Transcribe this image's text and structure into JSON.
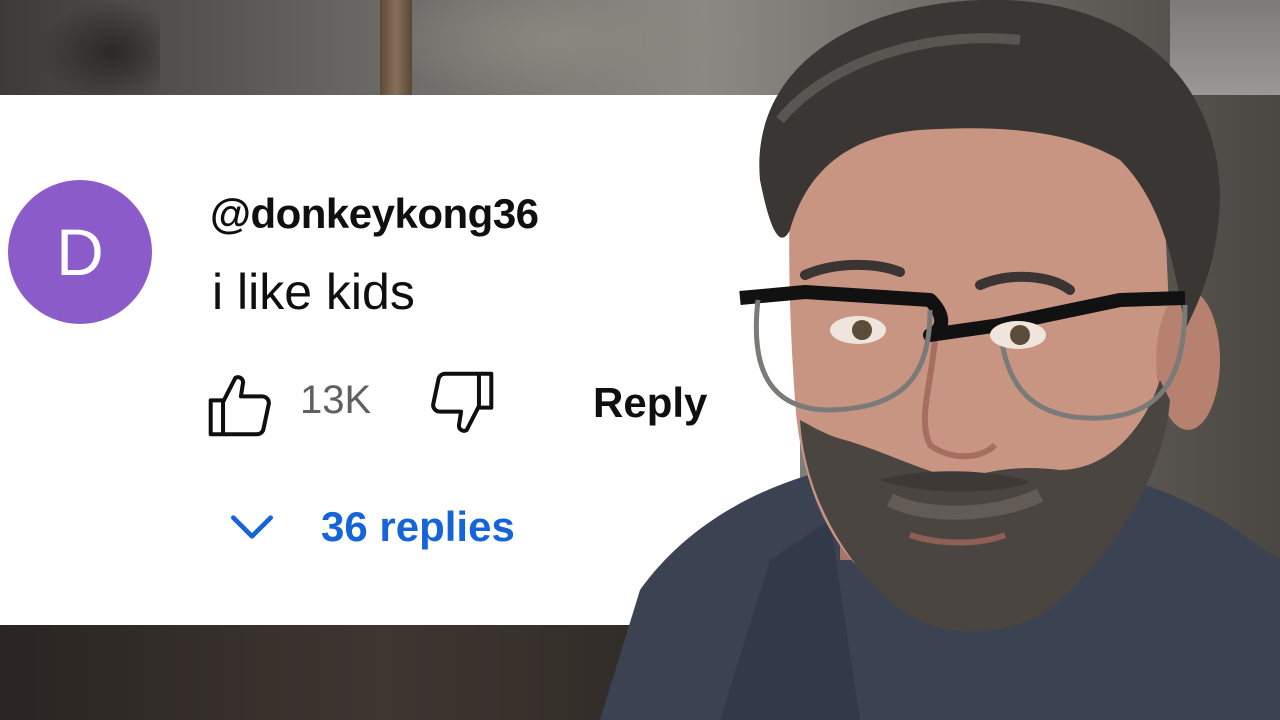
{
  "comment": {
    "avatar_letter": "D",
    "username": "@donkeykong36",
    "text": "i like kids",
    "like_count": "13K",
    "reply_label": "Reply",
    "replies_label": "36 replies"
  },
  "colors": {
    "avatar": "#8a5bc9",
    "replies_link": "#1565d8",
    "like_count": "#606060"
  },
  "icons": {
    "like": "thumbs-up-icon",
    "dislike": "thumbs-down-icon",
    "expand": "chevron-down-icon"
  }
}
